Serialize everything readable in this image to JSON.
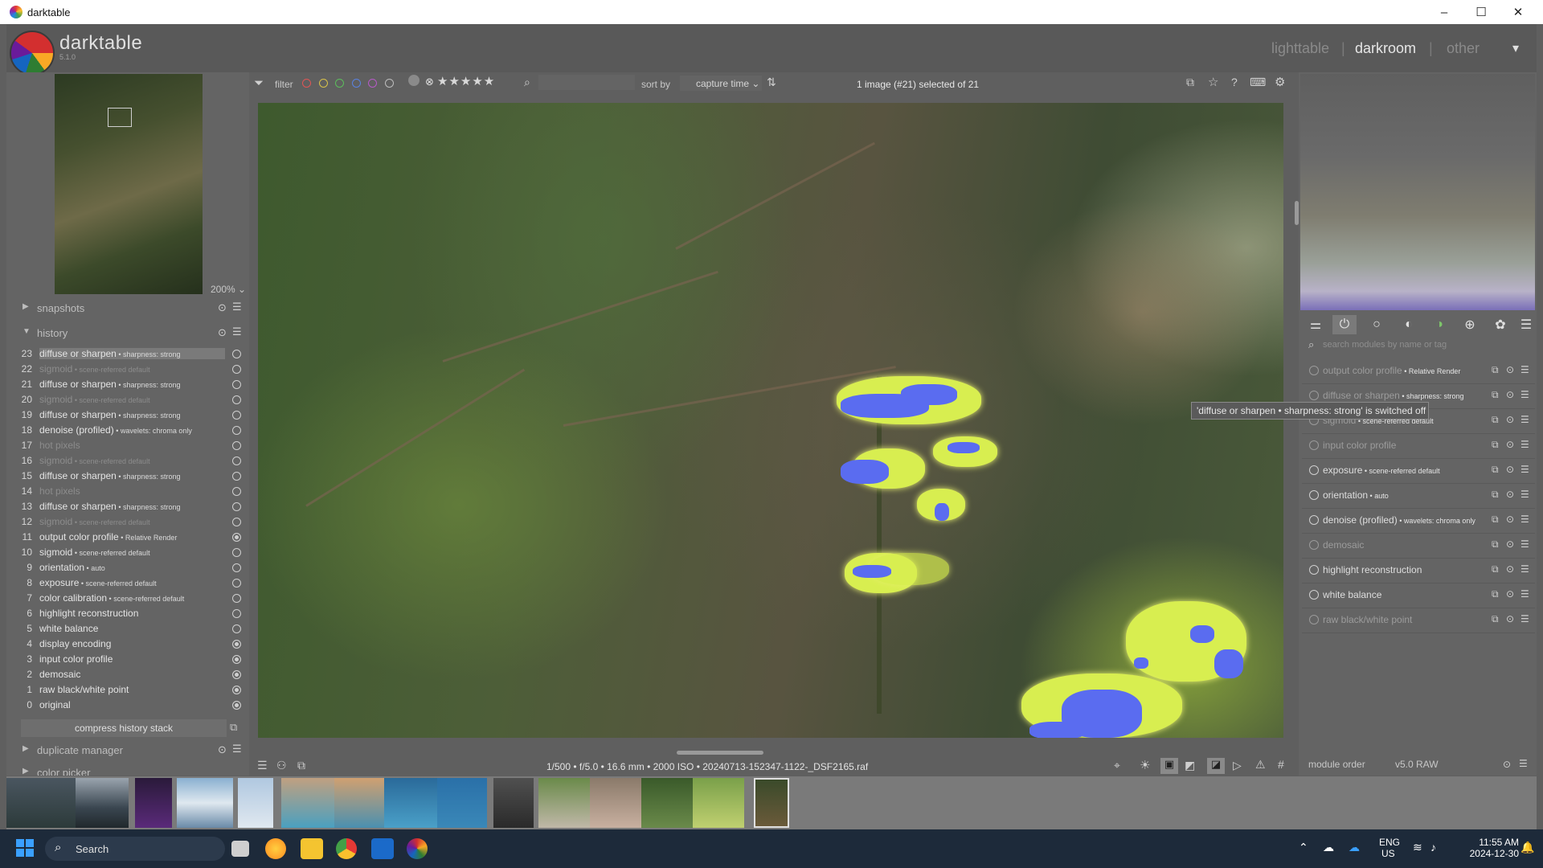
{
  "window": {
    "title": "darktable",
    "controls": [
      "–",
      "☐",
      "✕"
    ]
  },
  "header": {
    "app_name": "darktable",
    "version": "5.1.0",
    "views": [
      "lighttable",
      "darkroom",
      "other"
    ],
    "active_view": "darkroom",
    "separator": "|",
    "menu_icon": "▾"
  },
  "left": {
    "nav_zoom": "200%",
    "snapshots_label": "snapshots",
    "history_label": "history",
    "history": [
      {
        "n": "23",
        "name": "diffuse or sharpen",
        "detail": "sharpness: strong",
        "off": false,
        "state": "on"
      },
      {
        "n": "22",
        "name": "sigmoid",
        "detail": "scene-referred default",
        "off": true,
        "state": "on"
      },
      {
        "n": "21",
        "name": "diffuse or sharpen",
        "detail": "sharpness: strong",
        "off": false,
        "state": "on"
      },
      {
        "n": "20",
        "name": "sigmoid",
        "detail": "scene-referred default",
        "off": true,
        "state": "on"
      },
      {
        "n": "19",
        "name": "diffuse or sharpen",
        "detail": "sharpness: strong",
        "off": false,
        "state": "on"
      },
      {
        "n": "18",
        "name": "denoise (profiled)",
        "detail": "wavelets: chroma only",
        "off": false,
        "state": "on"
      },
      {
        "n": "17",
        "name": "hot pixels",
        "detail": "",
        "off": true,
        "state": "on"
      },
      {
        "n": "16",
        "name": "sigmoid",
        "detail": "scene-referred default",
        "off": true,
        "state": "on"
      },
      {
        "n": "15",
        "name": "diffuse or sharpen",
        "detail": "sharpness: strong",
        "off": false,
        "state": "on"
      },
      {
        "n": "14",
        "name": "hot pixels",
        "detail": "",
        "off": true,
        "state": "on"
      },
      {
        "n": "13",
        "name": "diffuse or sharpen",
        "detail": "sharpness: strong",
        "off": false,
        "state": "on"
      },
      {
        "n": "12",
        "name": "sigmoid",
        "detail": "scene-referred default",
        "off": true,
        "state": "on"
      },
      {
        "n": "11",
        "name": "output color profile",
        "detail": "Relative Render",
        "off": false,
        "state": "def"
      },
      {
        "n": "10",
        "name": "sigmoid",
        "detail": "scene-referred default",
        "off": false,
        "state": "on"
      },
      {
        "n": "9",
        "name": "orientation",
        "detail": "auto",
        "off": false,
        "state": "on"
      },
      {
        "n": "8",
        "name": "exposure",
        "detail": "scene-referred default",
        "off": false,
        "state": "on"
      },
      {
        "n": "7",
        "name": "color calibration",
        "detail": "scene-referred default",
        "off": false,
        "state": "on"
      },
      {
        "n": "6",
        "name": "highlight reconstruction",
        "detail": "",
        "off": false,
        "state": "on"
      },
      {
        "n": "5",
        "name": "white balance",
        "detail": "",
        "off": false,
        "state": "on"
      },
      {
        "n": "4",
        "name": "display encoding",
        "detail": "",
        "off": false,
        "state": "def"
      },
      {
        "n": "3",
        "name": "input color profile",
        "detail": "",
        "off": false,
        "state": "def"
      },
      {
        "n": "2",
        "name": "demosaic",
        "detail": "",
        "off": false,
        "state": "def"
      },
      {
        "n": "1",
        "name": "raw black/white point",
        "detail": "",
        "off": false,
        "state": "def"
      },
      {
        "n": "0",
        "name": "original",
        "detail": "",
        "off": false,
        "state": "def"
      }
    ],
    "compress_label": "compress history stack",
    "duplicate_label": "duplicate manager",
    "color_picker_label": "color picker"
  },
  "toolbar": {
    "filter_label": "filter",
    "color_labels": [
      "#e05555",
      "#d8c24a",
      "#5cbd5c",
      "#5a82e0",
      "#b65ac8",
      "#bdbdbd"
    ],
    "stars": "★★★★★",
    "sort_label": "sort by",
    "sort_value": "capture time",
    "count_text": "1 image (#21) selected of 21"
  },
  "bottom": {
    "exif": "1/500 • f/5.0 • 16.6 mm • 2000 ISO • 20240713-152347-1122-_DSF2165.raf"
  },
  "right": {
    "search_placeholder": "search modules by name or tag",
    "modules": [
      {
        "name": "output color profile",
        "detail": "Relative Render",
        "off": true
      },
      {
        "name": "diffuse or sharpen",
        "detail": "sharpness: strong",
        "off": true
      },
      {
        "name": "sigmoid",
        "detail": "scene-referred default",
        "off": true
      },
      {
        "name": "input color profile",
        "detail": "",
        "off": true
      },
      {
        "name": "exposure",
        "detail": "scene-referred default",
        "off": false
      },
      {
        "name": "orientation",
        "detail": "auto",
        "off": false
      },
      {
        "name": "denoise (profiled)",
        "detail": "wavelets: chroma only",
        "off": false
      },
      {
        "name": "demosaic",
        "detail": "",
        "off": true
      },
      {
        "name": "highlight reconstruction",
        "detail": "",
        "off": false
      },
      {
        "name": "white balance",
        "detail": "",
        "off": false
      },
      {
        "name": "raw black/white point",
        "detail": "",
        "off": true
      }
    ],
    "tooltip": "'diffuse or sharpen • sharpness: strong' is switched off",
    "module_order_label": "module order",
    "module_order_value": "v5.0 RAW"
  },
  "taskbar": {
    "search": "Search",
    "lang1": "ENG",
    "lang2": "US",
    "time": "11:55 AM",
    "date": "2024-12-30"
  }
}
